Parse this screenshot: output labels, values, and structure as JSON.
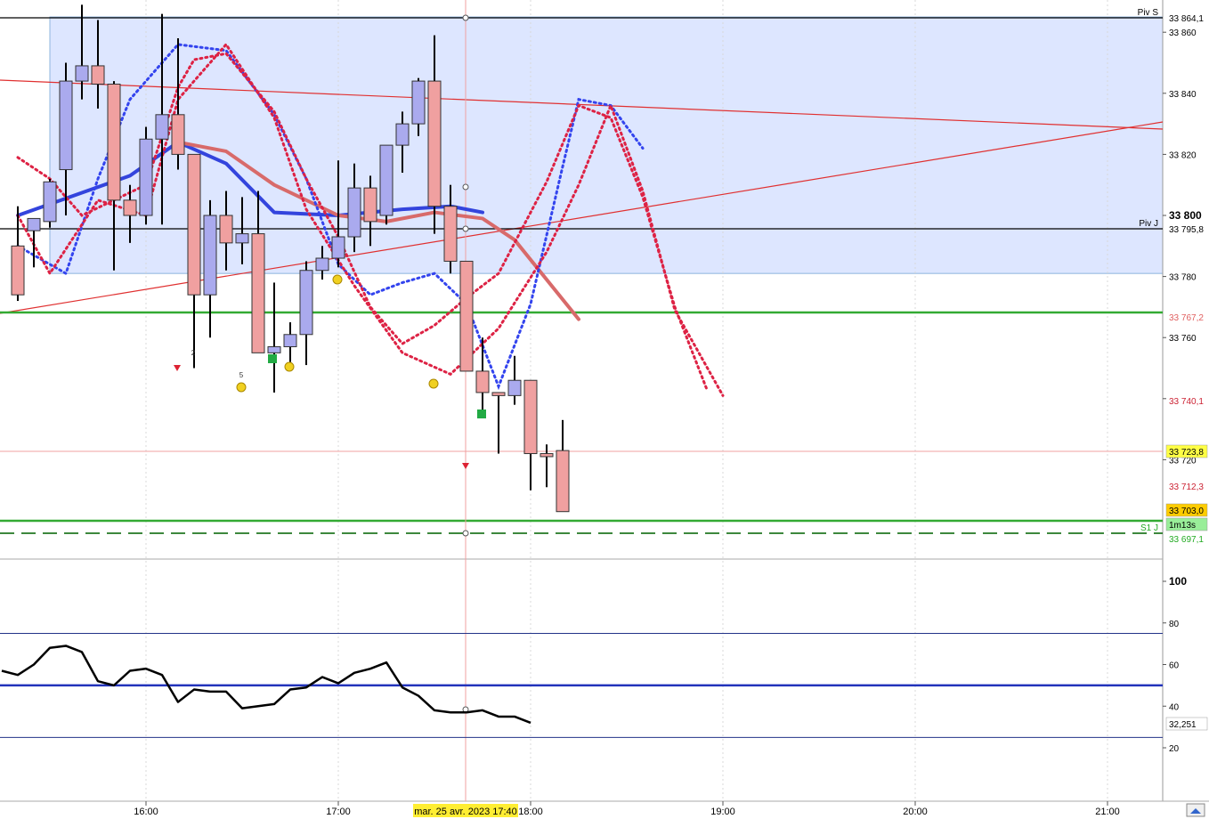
{
  "chart_data": [
    {
      "type": "candlestick",
      "yticks": [
        "33 860",
        "33 840",
        "33 820",
        "33 800",
        "33 780",
        "33 760",
        "33 740",
        "33 720"
      ],
      "xticks": [
        "16:00",
        "17:00",
        "18:00",
        "19:00",
        "20:00",
        "21:00"
      ],
      "crosshair_time": "mar. 25 avr. 2023 17:40",
      "ylim": [
        33690,
        33869
      ],
      "candles": [
        {
          "t": "15:16",
          "o": 33790,
          "h": 33803,
          "l": 33772,
          "c": 33774
        },
        {
          "t": "15:20",
          "o": 33795,
          "h": 33799,
          "l": 33783,
          "c": 33799
        },
        {
          "t": "15:25",
          "o": 33798,
          "h": 33812,
          "l": 33796,
          "c": 33811
        },
        {
          "t": "15:30",
          "o": 33815,
          "h": 33850,
          "l": 33800,
          "c": 33844
        },
        {
          "t": "15:35",
          "o": 33844,
          "h": 33869,
          "l": 33838,
          "c": 33849
        },
        {
          "t": "15:40",
          "o": 33849,
          "h": 33864,
          "l": 33835,
          "c": 33843
        },
        {
          "t": "15:45",
          "o": 33843,
          "h": 33844,
          "l": 33782,
          "c": 33805
        },
        {
          "t": "15:50",
          "o": 33805,
          "h": 33810,
          "l": 33791,
          "c": 33800
        },
        {
          "t": "15:55",
          "o": 33800,
          "h": 33829,
          "l": 33797,
          "c": 33825
        },
        {
          "t": "16:00",
          "o": 33825,
          "h": 33866,
          "l": 33797,
          "c": 33833
        },
        {
          "t": "16:05",
          "o": 33833,
          "h": 33858,
          "l": 33815,
          "c": 33820
        },
        {
          "t": "16:10",
          "o": 33820,
          "h": 33820,
          "l": 33750,
          "c": 33774
        },
        {
          "t": "16:15",
          "o": 33774,
          "h": 33805,
          "l": 33760,
          "c": 33800
        },
        {
          "t": "16:20",
          "o": 33800,
          "h": 33808,
          "l": 33782,
          "c": 33791
        },
        {
          "t": "16:25",
          "o": 33791,
          "h": 33806,
          "l": 33784,
          "c": 33794
        },
        {
          "t": "16:30",
          "o": 33794,
          "h": 33808,
          "l": 33755,
          "c": 33755
        },
        {
          "t": "16:35",
          "o": 33755,
          "h": 33778,
          "l": 33742,
          "c": 33757
        },
        {
          "t": "16:40",
          "o": 33757,
          "h": 33765,
          "l": 33752,
          "c": 33761
        },
        {
          "t": "16:45",
          "o": 33761,
          "h": 33785,
          "l": 33751,
          "c": 33782
        },
        {
          "t": "16:50",
          "o": 33782,
          "h": 33790,
          "l": 33779,
          "c": 33786
        },
        {
          "t": "16:55",
          "o": 33786,
          "h": 33818,
          "l": 33783,
          "c": 33793
        },
        {
          "t": "17:00",
          "o": 33793,
          "h": 33817,
          "l": 33788,
          "c": 33809
        },
        {
          "t": "17:05",
          "o": 33809,
          "h": 33813,
          "l": 33790,
          "c": 33798
        },
        {
          "t": "17:10",
          "o": 33800,
          "h": 33823,
          "l": 33797,
          "c": 33823
        },
        {
          "t": "17:15",
          "o": 33823,
          "h": 33834,
          "l": 33814,
          "c": 33830
        },
        {
          "t": "17:20",
          "o": 33830,
          "h": 33845,
          "l": 33826,
          "c": 33844
        },
        {
          "t": "17:25",
          "o": 33844,
          "h": 33859,
          "l": 33794,
          "c": 33803
        },
        {
          "t": "17:30",
          "o": 33803,
          "h": 33810,
          "l": 33781,
          "c": 33785
        },
        {
          "t": "17:35",
          "o": 33785,
          "h": 33785,
          "l": 33749,
          "c": 33749
        },
        {
          "t": "17:40",
          "o": 33749,
          "h": 33760,
          "l": 33736,
          "c": 33742
        },
        {
          "t": "17:45",
          "o": 33742,
          "h": 33742,
          "l": 33722,
          "c": 33741
        },
        {
          "t": "17:50",
          "o": 33741,
          "h": 33754,
          "l": 33738,
          "c": 33746
        },
        {
          "t": "17:55",
          "o": 33746,
          "h": 33746,
          "l": 33710,
          "c": 33722
        },
        {
          "t": "18:00",
          "o": 33722,
          "h": 33725,
          "l": 33711,
          "c": 33721
        },
        {
          "t": "18:03",
          "o": 33723,
          "h": 33733,
          "l": 33703,
          "c": 33703
        }
      ],
      "ma_blue": [
        [
          0,
          33800
        ],
        [
          7,
          33813
        ],
        [
          10,
          33824
        ],
        [
          13,
          33817
        ],
        [
          16,
          33801
        ],
        [
          20,
          33800
        ],
        [
          24,
          33802
        ],
        [
          27,
          33803
        ],
        [
          29,
          33801
        ]
      ],
      "ma_red": [
        [
          10,
          33824
        ],
        [
          13,
          33821
        ],
        [
          16,
          33810
        ],
        [
          20,
          33800
        ],
        [
          23,
          33798
        ],
        [
          26,
          33801
        ],
        [
          29,
          33799
        ],
        [
          31,
          33792
        ],
        [
          35,
          33766
        ]
      ],
      "psar_blue": [
        [
          0,
          33790
        ],
        [
          3,
          33781
        ],
        [
          5,
          33812
        ],
        [
          7,
          33838
        ],
        [
          10,
          33856
        ],
        [
          13,
          33854
        ],
        [
          16,
          33833
        ],
        [
          18,
          33812
        ],
        [
          20,
          33784
        ],
        [
          22,
          33774
        ],
        [
          24,
          33778
        ],
        [
          26,
          33781
        ],
        [
          28,
          33771
        ],
        [
          30,
          33744
        ],
        [
          32,
          33771
        ],
        [
          34,
          33816
        ],
        [
          35,
          33838
        ],
        [
          37,
          33836
        ],
        [
          39,
          33822
        ]
      ],
      "psar_red": [
        [
          0,
          33819
        ],
        [
          2,
          33812
        ],
        [
          4,
          33800
        ],
        [
          8,
          33810
        ],
        [
          10,
          33842
        ],
        [
          11,
          33851
        ],
        [
          13,
          33853
        ],
        [
          16,
          33834
        ],
        [
          18,
          33812
        ],
        [
          20,
          33793
        ],
        [
          22,
          33770
        ],
        [
          24,
          33758
        ],
        [
          26,
          33764
        ],
        [
          28,
          33773
        ],
        [
          30,
          33781
        ],
        [
          33,
          33811
        ],
        [
          35,
          33836
        ],
        [
          37,
          33832
        ],
        [
          39,
          33806
        ],
        [
          41,
          33770
        ],
        [
          43,
          33743
        ]
      ],
      "dotted_red_psar": [
        [
          0,
          33800
        ],
        [
          2,
          33781
        ],
        [
          5,
          33805
        ],
        [
          8,
          33800
        ],
        [
          10,
          33838
        ],
        [
          13,
          33856
        ],
        [
          16,
          33832
        ],
        [
          18,
          33802
        ],
        [
          21,
          33777
        ],
        [
          24,
          33755
        ],
        [
          27,
          33748
        ],
        [
          30,
          33763
        ],
        [
          33,
          33788
        ],
        [
          35,
          33810
        ],
        [
          37,
          33836
        ],
        [
          39,
          33808
        ],
        [
          41,
          33769
        ],
        [
          44,
          33741
        ]
      ],
      "horizontal_lines": [
        {
          "name": "Piv S",
          "value": 33864.1,
          "color": "#000000"
        },
        {
          "name": "Piv J",
          "value": 33795.8,
          "color": "#000000"
        },
        {
          "name": "",
          "value": 33767.2,
          "color": "#33aa33"
        },
        {
          "name": "",
          "value": 33703.0,
          "color": "#33aa33"
        },
        {
          "name": "S1 J",
          "value": 33697.1,
          "color": "#33aa33"
        }
      ],
      "price_labels": [
        {
          "value": "33 864,1",
          "bg": "#ffffff",
          "fg": "#000000"
        },
        {
          "value": "33 795,8",
          "bg": "#ffffff",
          "fg": "#000000"
        },
        {
          "value": "33 767,2",
          "bg": "#ffffff",
          "fg": "#e06060"
        },
        {
          "value": "33 740,1",
          "bg": "#ffffff",
          "fg": "#cc2233"
        },
        {
          "value": "33 723,8",
          "bg": "#ffff44",
          "fg": "#000000"
        },
        {
          "value": "33 712,3",
          "bg": "#ffffff",
          "fg": "#cc2233"
        },
        {
          "value": "33 703,0",
          "bg": "#ffcc00",
          "fg": "#000000"
        },
        {
          "value": "1m13s",
          "bg": "#99ee99",
          "fg": "#000000"
        },
        {
          "value": "33 697,1",
          "bg": "#ffffff",
          "fg": "#22aa22"
        }
      ],
      "bold_tick": "33 800",
      "signal_counts": [
        "2",
        "5"
      ]
    },
    {
      "type": "line",
      "yticks": [
        "100",
        "80",
        "60",
        "40",
        "20"
      ],
      "ylim": [
        0,
        100
      ],
      "levels": [
        75,
        50,
        25
      ],
      "current_value": "32,251",
      "values": [
        57,
        55,
        60,
        68,
        69,
        66,
        52,
        50,
        57,
        58,
        55,
        42,
        48,
        47,
        47,
        39,
        40,
        41,
        48,
        49,
        54,
        51,
        56,
        58,
        61,
        49,
        45,
        38,
        37,
        37,
        38,
        35,
        35,
        32
      ]
    }
  ]
}
